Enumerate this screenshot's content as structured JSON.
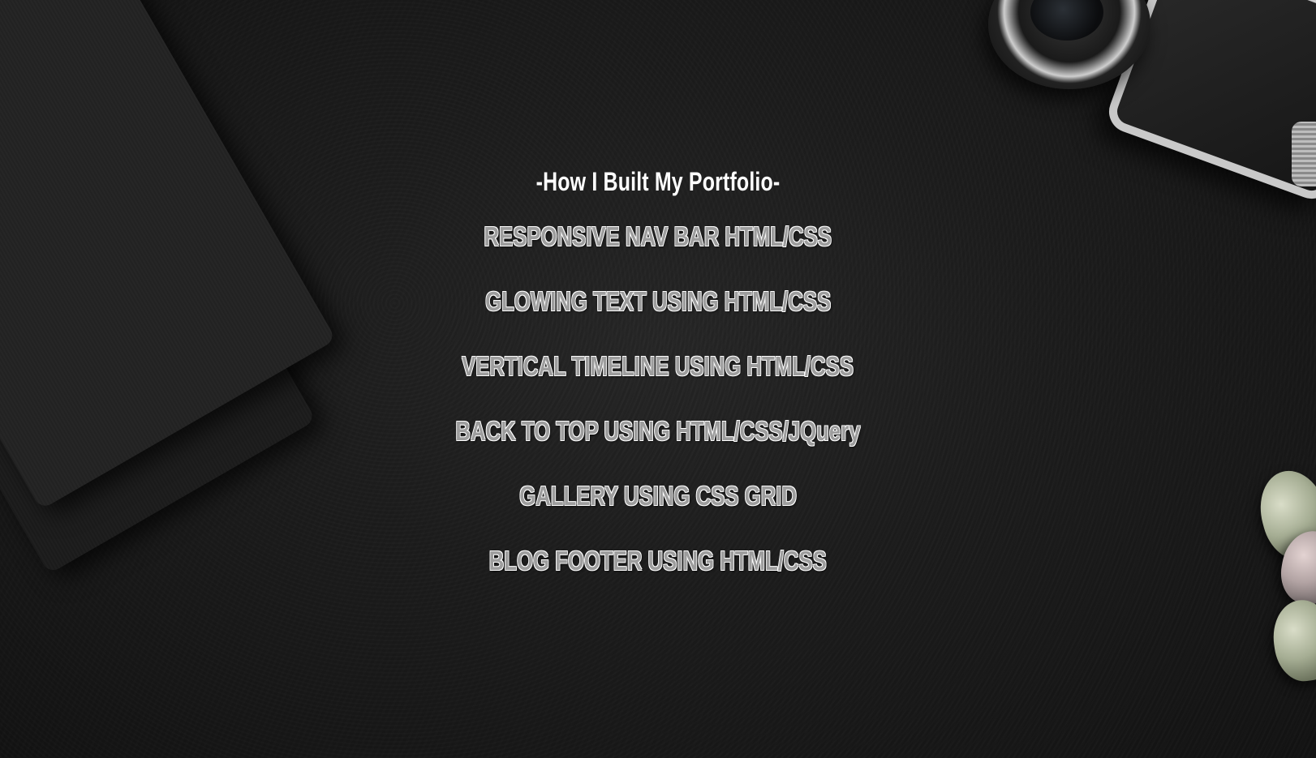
{
  "page": {
    "title": "-How I Built My Portfolio-"
  },
  "menu": {
    "items": [
      {
        "label": "RESPONSIVE NAV BAR HTML/CSS"
      },
      {
        "label": "GLOWING TEXT USING HTML/CSS"
      },
      {
        "label": "VERTICAL TIMELINE USING HTML/CSS"
      },
      {
        "label": "BACK TO TOP USING HTML/CSS/JQuery"
      },
      {
        "label": "GALLERY USING CSS GRID"
      },
      {
        "label": "BLOG FOOTER USING HTML/CSS"
      }
    ]
  },
  "colors": {
    "background": "#1c1c1c",
    "title": "#ffffff",
    "link_fill": "#9d9d9d",
    "link_outline": "#ffffff"
  },
  "background_objects": [
    "notebook-icon",
    "camera-icon",
    "succulent-icon"
  ]
}
